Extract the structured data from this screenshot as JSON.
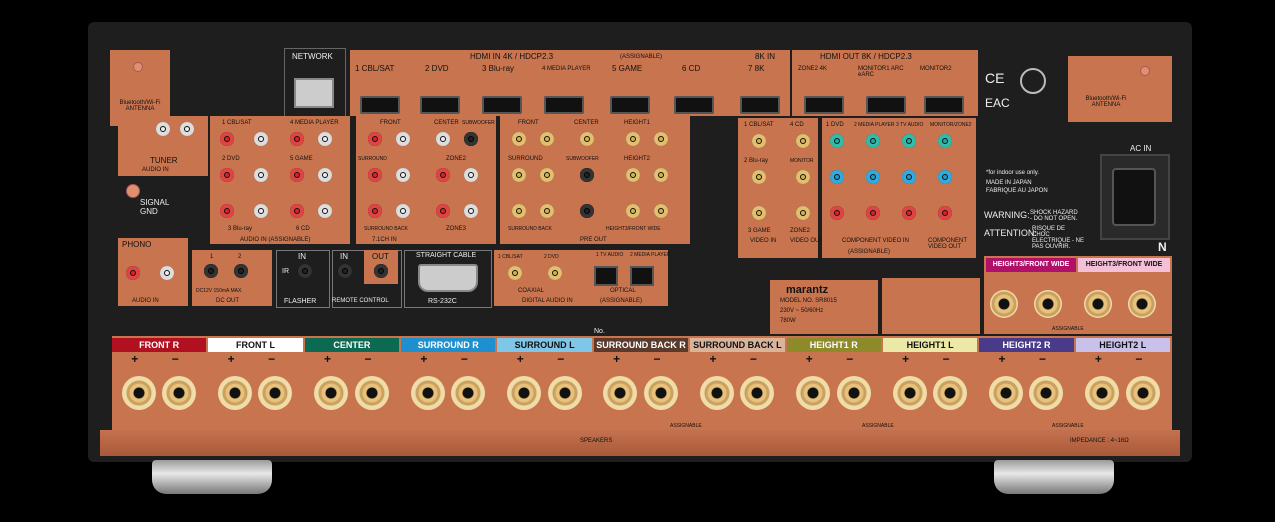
{
  "network": {
    "label": "NETWORK"
  },
  "bt_left": {
    "label": "Bluetooth/Wi-Fi ANTENNA"
  },
  "bt_right": {
    "label": "Bluetooth/Wi-Fi ANTENNA"
  },
  "hdmi_in": {
    "title": "HDMI IN  4K / HDCP2.3",
    "assign": "(ASSIGNABLE)",
    "ports": [
      "1 CBL/SAT",
      "2 DVD",
      "3 Blu-ray",
      "4 MEDIA PLAYER",
      "5 GAME",
      "6 CD"
    ],
    "eightk_title": "8K IN",
    "eightk_port": "7 8K"
  },
  "hdmi_out": {
    "title": "HDMI OUT  8K / HDCP2.3",
    "ports": [
      "ZONE2  4K",
      "MONITOR1  ARC eARC",
      "MONITOR2"
    ]
  },
  "certs": {
    "ce": "CE",
    "eac": "EAC"
  },
  "analog": {
    "tuner": "TUNER",
    "audio_in": "AUDIO IN",
    "audio_in_assign": "AUDIO IN (ASSIGNABLE)",
    "labels": [
      "1 CBL/SAT",
      "4 MEDIA PLAYER",
      "2 DVD",
      "5 GAME",
      "3 Blu-ray",
      "6 CD"
    ],
    "signal_gnd": "SIGNAL GND",
    "in71": "7.1CH IN",
    "front": "FRONT",
    "center": "CENTER",
    "subwoofer": "SUBWOOFER",
    "surround": "SURROUND",
    "surround_back": "SURROUND BACK",
    "zone2": "ZONE2",
    "zone3": "ZONE3",
    "pre_out": "PRE OUT",
    "pre_labels": [
      "FRONT",
      "CENTER",
      "HEIGHT1",
      "SURROUND",
      "SUBWOOFER",
      "HEIGHT2",
      "SURROUND BACK",
      "HEIGHT3/FRONT WIDE"
    ]
  },
  "video": {
    "video_in": "VIDEO IN",
    "video_out": "VIDEO OUT",
    "component_in": "COMPONENT VIDEO IN",
    "component_out": "COMPONENT VIDEO OUT",
    "assign": "(ASSIGNABLE)",
    "labels": [
      "1 CBL/SAT",
      "4 CD",
      "2 Blu-ray",
      "MONITOR",
      "3 GAME",
      "ZONE2",
      "1 DVD",
      "2 MEDIA PLAYER",
      "3 TV AUDIO",
      "MONITOR/ZONE2"
    ]
  },
  "warning": {
    "indoor": "*for indoor use only.",
    "made": "MADE IN JAPAN",
    "fabrique": "FABRIQUE AU JAPON",
    "warn": "WARNING:",
    "warn_text": "SHOCK HAZARD - DO NOT OPEN.",
    "attn": "ATTENTION:",
    "attn_text": "RISQUE DE CHOC ELECTRIQUE - NE PAS OUVRIR."
  },
  "ac_in": "AC IN",
  "phono": {
    "label": "PHONO",
    "audio_in": "AUDIO IN"
  },
  "dc_out": {
    "label": "DC OUT",
    "spec": "DC12V 150mA MAX.",
    "ports": [
      "1",
      "2"
    ]
  },
  "flasher": {
    "label": "FLASHER",
    "in": "IN",
    "ir": "IR"
  },
  "remote": {
    "label": "REMOTE CONTROL",
    "in": "IN",
    "out": "OUT"
  },
  "rs232": {
    "label": "RS-232C",
    "straight": "STRAIGHT CABLE"
  },
  "digital": {
    "title": "DIGITAL AUDIO IN",
    "assign": "(ASSIGNABLE)",
    "coax": "COAXIAL",
    "optical": "OPTICAL",
    "labels": [
      "1 CBL/SAT",
      "2 DVD",
      "1 TV AUDIO",
      "2 MEDIA PLAYER"
    ]
  },
  "model": {
    "brand": "marantz",
    "model": "MODEL NO. SR8015",
    "power": "230V ~ 50/60Hz",
    "watts": "780W"
  },
  "no_label": "No.",
  "height3": {
    "r": "HEIGHT3/FRONT WIDE",
    "l": "HEIGHT3/FRONT WIDE",
    "assign": "ASSIGNABLE"
  },
  "speakers": {
    "channels": [
      {
        "name": "FRONT",
        "side": "R",
        "color": "#b01020",
        "fg": "#fff"
      },
      {
        "name": "FRONT",
        "side": "L",
        "color": "#ffffff",
        "fg": "#111"
      },
      {
        "name": "CENTER",
        "side": "",
        "color": "#0c6a52",
        "fg": "#fff"
      },
      {
        "name": "SURROUND",
        "side": "R",
        "color": "#1e8fcf",
        "fg": "#fff"
      },
      {
        "name": "SURROUND",
        "side": "L",
        "color": "#7fc6e8",
        "fg": "#111"
      },
      {
        "name": "SURROUND BACK",
        "side": "R",
        "color": "#5a3a2a",
        "fg": "#fff"
      },
      {
        "name": "SURROUND BACK",
        "side": "L",
        "color": "#d9b39a",
        "fg": "#111"
      },
      {
        "name": "HEIGHT1",
        "side": "R",
        "color": "#8e8a2a",
        "fg": "#fff"
      },
      {
        "name": "HEIGHT1",
        "side": "L",
        "color": "#ece9a8",
        "fg": "#111"
      },
      {
        "name": "HEIGHT2",
        "side": "R",
        "color": "#4a3a8a",
        "fg": "#fff"
      },
      {
        "name": "HEIGHT2",
        "side": "L",
        "color": "#c9c1ea",
        "fg": "#111"
      }
    ],
    "assignable": "ASSIGNABLE",
    "footer": "SPEAKERS",
    "impedance": "IMPEDANCE : 4~16Ω"
  },
  "n_mark": "N"
}
